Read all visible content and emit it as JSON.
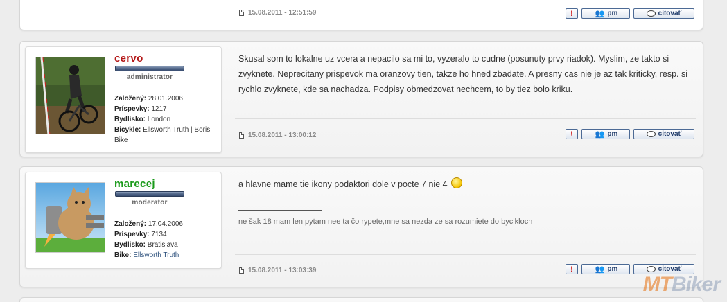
{
  "posts": [
    {
      "timestamp": "15.08.2011 - 12:51:59"
    },
    {
      "username": "cervo",
      "username_color": "#b31717",
      "rank": "administrator",
      "info": [
        {
          "label": "Založený:",
          "value": "28.01.2006"
        },
        {
          "label": "Príspevky:",
          "value": "1217"
        },
        {
          "label": "Bydlisko:",
          "value": "London"
        },
        {
          "label": "Bicykle:",
          "value": "Ellsworth Truth | Boris Bike"
        }
      ],
      "avatar_icon": "mountain-biker-photo",
      "content": "Skusal som to lokalne uz vcera a nepacilo sa mi to, vyzeralo to cudne (posunuty prvy riadok). Myslim, ze takto si zvyknete. Neprecitany prispevok ma oranzovy tien, takze ho hned zbadate. A presny cas nie je az tak kriticky, resp. si rychlo zvyknete, kde sa nachadza. Podpisy obmedzovat nechcem, to by tiez bolo kriku.",
      "timestamp": "15.08.2011 - 13:00:12"
    },
    {
      "username": "marecej",
      "username_color": "#1a9a1a",
      "rank": "moderator",
      "info": [
        {
          "label": "Založený:",
          "value": "17.04.2006"
        },
        {
          "label": "Príspevky:",
          "value": "7134"
        },
        {
          "label": "Bydlisko:",
          "value": "Bratislava"
        },
        {
          "label": "Bike:",
          "value": "Ellsworth Truth"
        }
      ],
      "avatar_icon": "jetpack-cat-cartoon",
      "content": "a hlavne mame tie ikony podaktori dole v pocte 7 nie 4",
      "signature": "ne šak 18 mam len pytam nee ta čo rypete,mne sa nezda ze sa rozumiete do bycikloch",
      "timestamp": "15.08.2011 - 13:03:39"
    }
  ],
  "buttons": {
    "report": "!",
    "pm": "pm",
    "quote": "citovať"
  },
  "icons": {
    "report": "exclamation-icon",
    "pm": "users-icon",
    "quote": "speech-bubble-icon",
    "meta": "document-icon",
    "smiley": "smiley-icon"
  },
  "watermark": {
    "part1": "MT",
    "part2": "Biker"
  }
}
